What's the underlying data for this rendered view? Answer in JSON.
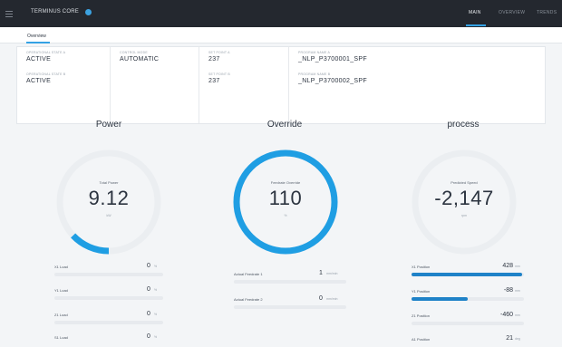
{
  "topbar": {
    "app_title": "TERMINUS CORE",
    "nav": [
      "MAIN",
      "OVERVIEW",
      "TRENDS"
    ]
  },
  "subtabs": [
    "Overview"
  ],
  "info_panel": {
    "col1": [
      {
        "label": "OPERATIONAL STATE A",
        "value": "ACTIVE"
      },
      {
        "label": "OPERATIONAL STATE B",
        "value": "ACTIVE"
      }
    ],
    "col2": [
      {
        "label": "CONTROL MODE",
        "value": "AUTOMATIC"
      }
    ],
    "col3": [
      {
        "label": "SET POINT A",
        "value": "237"
      },
      {
        "label": "SET POINT B",
        "value": "237"
      }
    ],
    "col4": [
      {
        "label": "PROGRAM NAME A",
        "value": "_NLP_P3700001_SPF"
      },
      {
        "label": "PROGRAM NAME B",
        "value": "_NLP_P3700002_SPF"
      }
    ]
  },
  "panels": {
    "power": {
      "title": "Power",
      "gauge_label": "Total Power",
      "value": "9.12",
      "unit": "kW",
      "fraction": 0.13,
      "metrics": [
        {
          "label": "X1 Load",
          "value": "0",
          "unit": "%",
          "fraction": 0
        },
        {
          "label": "Y1 Load",
          "value": "0",
          "unit": "%",
          "fraction": 0
        },
        {
          "label": "Z1 Load",
          "value": "0",
          "unit": "%",
          "fraction": 0
        },
        {
          "label": "S1 Load",
          "value": "0",
          "unit": "%",
          "fraction": 0
        }
      ]
    },
    "override": {
      "title": "Override",
      "gauge_label": "Feedrate Override",
      "value": "110",
      "unit": "%",
      "fraction": 1.0,
      "metrics": [
        {
          "label": "Actual Feedrate 1",
          "value": "1",
          "unit": "mm/min",
          "fraction": 0
        },
        {
          "label": "Actual Feedrate 2",
          "value": "0",
          "unit": "mm/min",
          "fraction": 0
        }
      ]
    },
    "process": {
      "title": "process",
      "gauge_label": "Predicted Speed",
      "value": "-2,147",
      "unit": "rpm",
      "fraction": 0,
      "metrics": [
        {
          "label": "X1 Position",
          "value": "428",
          "unit": "mm",
          "fraction": 0.98
        },
        {
          "label": "Y1 Position",
          "value": "-88",
          "unit": "mm",
          "fraction": 0.5
        },
        {
          "label": "Z1 Position",
          "value": "-460",
          "unit": "mm",
          "fraction": 0
        },
        {
          "label": "A1 Position",
          "value": "21",
          "unit": "deg",
          "fraction": 0
        }
      ]
    }
  },
  "colors": {
    "accent": "#1f9ee3",
    "topbar": "#24282f",
    "background": "#f3f5f7",
    "track": "#eceff2"
  }
}
